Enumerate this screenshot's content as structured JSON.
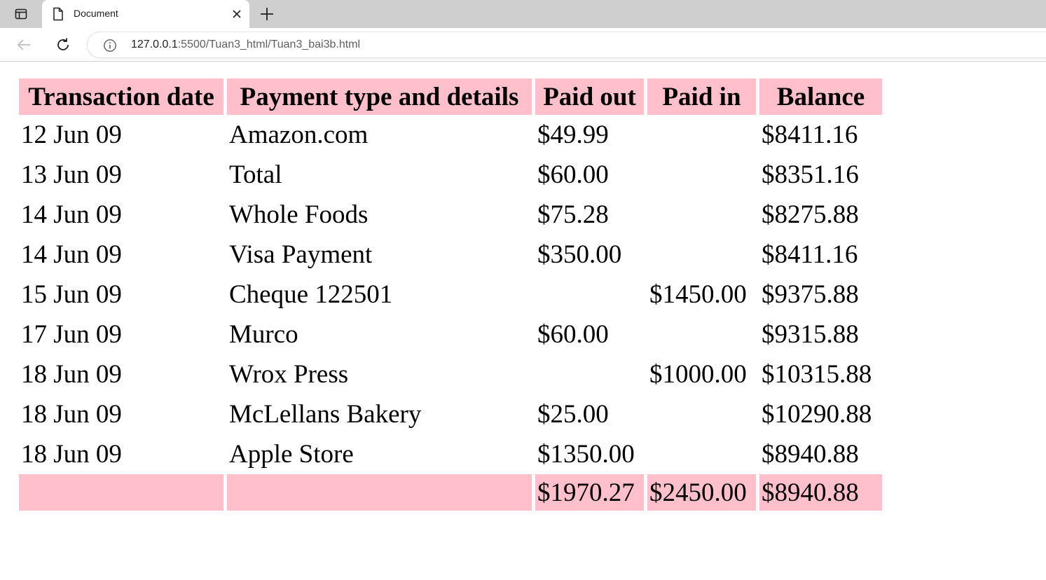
{
  "browser": {
    "tab": {
      "title": "Document",
      "icon": "document-icon"
    },
    "address": {
      "host": "127.0.0.1",
      "path": ":5500/Tuan3_html/Tuan3_bai3b.html"
    }
  },
  "table": {
    "headers": {
      "date": "Transaction date",
      "type": "Payment type and details",
      "paid_out": "Paid out",
      "paid_in": "Paid in",
      "balance": "Balance"
    },
    "rows": [
      {
        "date": "12 Jun 09",
        "type": "Amazon.com",
        "paid_out": "$49.99",
        "paid_in": "",
        "balance": "$8411.16"
      },
      {
        "date": "13 Jun 09",
        "type": "Total",
        "paid_out": "$60.00",
        "paid_in": "",
        "balance": "$8351.16"
      },
      {
        "date": "14 Jun 09",
        "type": "Whole Foods",
        "paid_out": "$75.28",
        "paid_in": "",
        "balance": "$8275.88"
      },
      {
        "date": "14 Jun 09",
        "type": "Visa Payment",
        "paid_out": "$350.00",
        "paid_in": "",
        "balance": "$8411.16"
      },
      {
        "date": "15 Jun 09",
        "type": "Cheque 122501",
        "paid_out": "",
        "paid_in": "$1450.00",
        "balance": "$9375.88"
      },
      {
        "date": "17 Jun 09",
        "type": "Murco",
        "paid_out": "$60.00",
        "paid_in": "",
        "balance": "$9315.88"
      },
      {
        "date": "18 Jun 09",
        "type": "Wrox Press",
        "paid_out": "",
        "paid_in": "$1000.00",
        "balance": "$10315.88"
      },
      {
        "date": "18 Jun 09",
        "type": "McLellans Bakery",
        "paid_out": "$25.00",
        "paid_in": "",
        "balance": "$10290.88"
      },
      {
        "date": "18 Jun 09",
        "type": "Apple Store",
        "paid_out": "$1350.00",
        "paid_in": "",
        "balance": "$8940.88"
      }
    ],
    "footer": {
      "date": "",
      "type": "",
      "paid_out": "$1970.27",
      "paid_in": "$2450.00",
      "balance": "$8940.88"
    }
  },
  "colors": {
    "header_bg": "#ffc0cb",
    "tabstrip_bg": "#cfcfcf"
  }
}
